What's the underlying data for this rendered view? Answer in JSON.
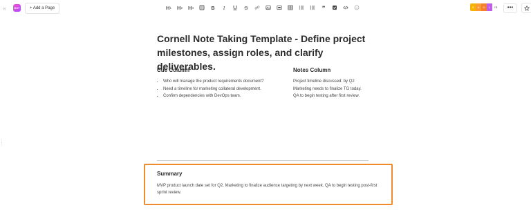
{
  "topbar": {
    "collapse_glyph": "«",
    "app_badge": "DXT",
    "add_page_label": "+ Add a Page",
    "toolbar_items": [
      {
        "name": "heading-1-button",
        "label": "H",
        "sub": "1"
      },
      {
        "name": "heading-2-button",
        "label": "H",
        "sub": "2"
      },
      {
        "name": "heading-3-button",
        "label": "H",
        "sub": "3"
      }
    ],
    "avatars": [
      "S",
      "A",
      "D",
      "J"
    ],
    "avatar_more": "+9",
    "more_label": "•••"
  },
  "document": {
    "title": "Cornell Note Taking Template - Define project milestones, assign roles, and clarify deliverables.",
    "cue": {
      "heading": "Cue Column",
      "items": [
        "Who will manage the product requirements document?",
        "Need a timeline for marketing collateral development.",
        "Confirm dependencies with DevOps team."
      ]
    },
    "notes": {
      "heading": "Notes Column",
      "lines": [
        "Project timeline discussed: by Q2",
        "Marketing needs to finalize TG today.",
        "QA to begin testing after first review."
      ]
    },
    "summary": {
      "heading": "Summary",
      "text": "MVP product launch date set for Q2. Marketing to finalize audience targeting by next week. QA to begin testing post-first sprint review."
    }
  },
  "colors": {
    "highlight_border": "#f08a2c",
    "badge_gradient": [
      "#ff4fd8",
      "#a44bff"
    ]
  }
}
